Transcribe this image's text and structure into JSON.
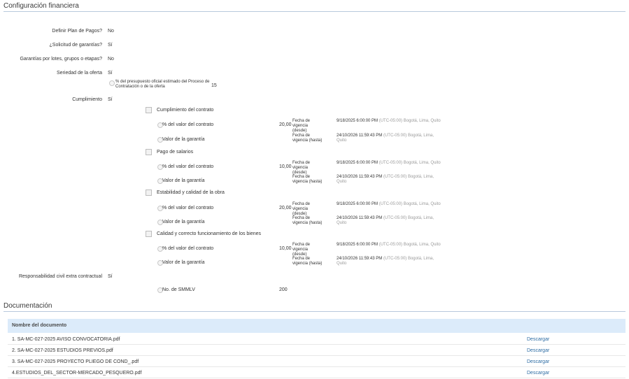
{
  "config": {
    "title": "Configuración financiera",
    "plan_pagos": {
      "label": "Definir Plan de Pagos?",
      "value": "No"
    },
    "solicitud_garantias": {
      "label": "¿Solicitud de garantías?",
      "value": "Sí"
    },
    "garantias_lotes": {
      "label": "Garantías por lotes, grupos o etapas?",
      "value": "No"
    },
    "seriedad": {
      "label": "Seriedad de la oferta",
      "value": "Sí",
      "pct_label": "% del presupuesto oficial estimado del Proceso de Contratación o de la oferta",
      "pct_value": "15"
    },
    "cumplimiento": {
      "label": "Cumplimiento",
      "value": "Sí"
    },
    "groups": [
      {
        "name": "Cumplimiento del contrato",
        "pct": "20,00"
      },
      {
        "name": "Pago de salarios",
        "pct": "10,00"
      },
      {
        "name": "Estabilidad y calidad de la obra",
        "pct": "20,00"
      },
      {
        "name": "Calidad y correcto funcionamiento de los bienes",
        "pct": "10,00"
      }
    ],
    "opt_pct": "% del valor del contrato",
    "opt_valor": "Valor de la garantía",
    "desde_label": "Fecha de vigencia (desde)",
    "hasta_label": "Fecha de vigencia (hasta)",
    "desde_value": "9/18/2025 6:00:00 PM",
    "hasta_value": "24/10/2026 11:59:43 PM",
    "tz_desde": "(UTC-05:00) Bogotá, Lima, Quito",
    "tz_hasta": "(UTC-05:00) Bogotá, Lima, Quito",
    "responsabilidad": {
      "label": "Responsabilidad civil extra contractual",
      "value": "Sí",
      "smmlv_label": "No. de SMMLV",
      "smmlv_value": "200"
    }
  },
  "docs": {
    "title": "Documentación",
    "column": "Nombre del documento",
    "download": "Descargar",
    "files": [
      "1. SA-MC-027-2025 AVISO CONVOCATORIA.pdf",
      "2. SA-MC-027-2025 ESTUDIOS PREVIOS.pdf",
      "3. SA-MC-027-2025 PROYECTO PLIEGO DE COND_.pdf",
      "4.ESTUDIOS_DEL_SECTOR-MERCADO_PESQUERO.pdf"
    ]
  }
}
